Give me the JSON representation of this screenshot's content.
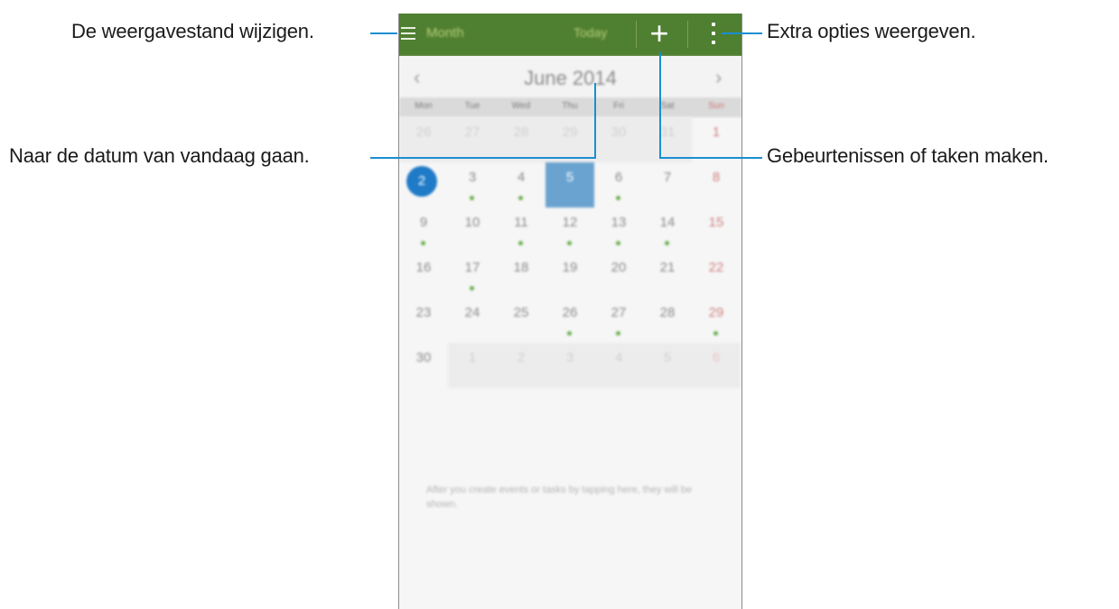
{
  "callouts": {
    "view_mode": "De weergavestand wijzigen.",
    "more_options": "Extra opties weergeven.",
    "go_today": "Naar de datum van vandaag gaan.",
    "create_event": "Gebeurtenissen of taken maken."
  },
  "actionbar": {
    "title": "Month",
    "today_label": "Today",
    "add_glyph": "+",
    "menu_icon": "hamburger-menu-icon",
    "more_icon": "more-vert-icon"
  },
  "calendar": {
    "month_label": "June 2014",
    "prev_glyph": "‹",
    "next_glyph": "›",
    "weekdays": [
      "Mon",
      "Tue",
      "Wed",
      "Thu",
      "Fri",
      "Sat",
      "Sun"
    ],
    "weeks": [
      [
        "26",
        "27",
        "28",
        "29",
        "30",
        "31",
        "1"
      ],
      [
        "2",
        "3",
        "4",
        "5",
        "6",
        "7",
        "8"
      ],
      [
        "9",
        "10",
        "11",
        "12",
        "13",
        "14",
        "15"
      ],
      [
        "16",
        "17",
        "18",
        "19",
        "20",
        "21",
        "22"
      ],
      [
        "23",
        "24",
        "25",
        "26",
        "27",
        "28",
        "29"
      ],
      [
        "30",
        "1",
        "2",
        "3",
        "4",
        "5",
        "6"
      ]
    ],
    "empty_message": "After you create events or tasks by tapping here, they will be shown."
  },
  "colors": {
    "accent": "#1a8fd1",
    "actionbar": "#4f7f30",
    "selected_day": "#1f7ac7",
    "today_box": "#6aa3d0",
    "event_dot": "#6ab04c"
  }
}
